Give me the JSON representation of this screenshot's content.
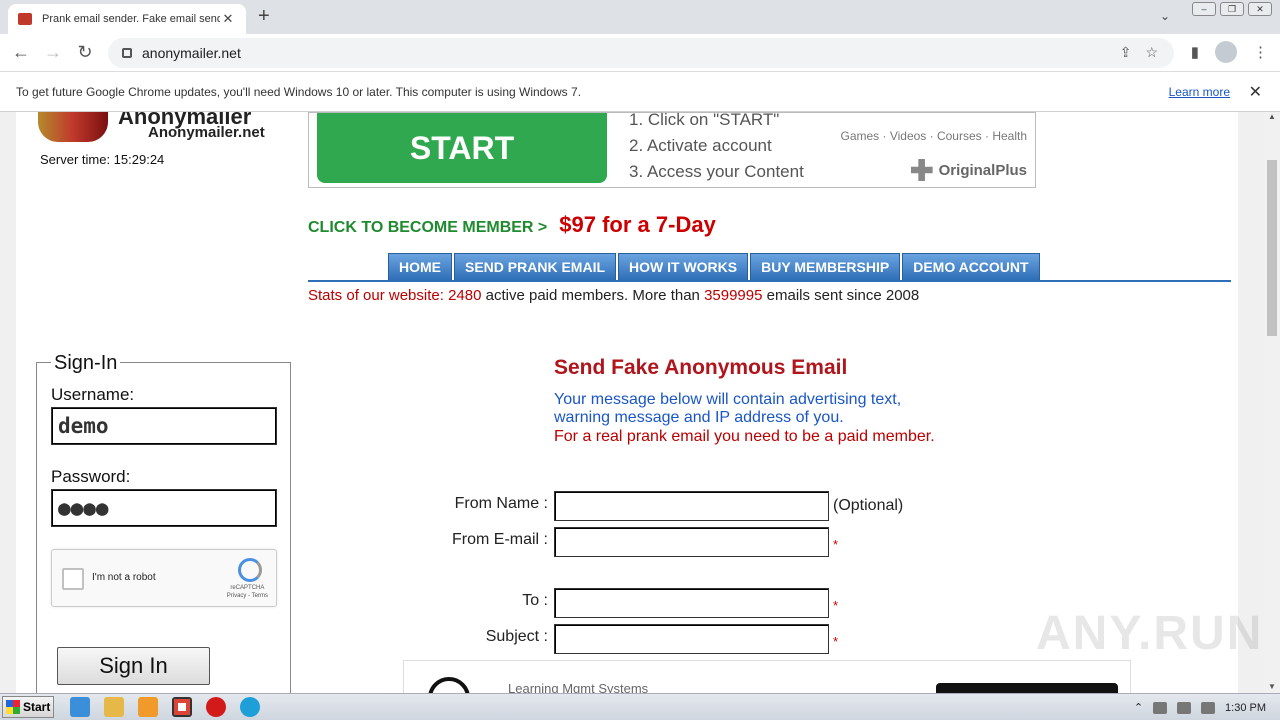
{
  "browser": {
    "tab_title": "Prank email sender. Fake email sender",
    "tab_close": "✕",
    "new_tab": "+",
    "url": "anonymailer.net",
    "infobar_text": "To get future Google Chrome updates, you'll need Windows 10 or later. This computer is using Windows 7.",
    "infobar_link": "Learn more",
    "infobar_close": "✕"
  },
  "site": {
    "logo_name": "Anonymailer.net",
    "logo_big": "Anonymailer",
    "server_time": "Server time: 15:29:24"
  },
  "ad": {
    "start_label": "START",
    "steps": [
      "1. Click on \"START\"",
      "2. Activate account",
      "3. Access your Content"
    ],
    "categories": "Games · Videos · Courses · Health",
    "brand": "OriginalPlus"
  },
  "cta": {
    "text": "CLICK TO BECOME MEMBER >",
    "price": "$97 for a 7-Day"
  },
  "nav": {
    "items": [
      "HOME",
      "SEND PRANK EMAIL",
      "HOW IT WORKS",
      "BUY MEMBERSHIP",
      "DEMO ACCOUNT"
    ]
  },
  "stats": {
    "label": "Stats of our website:",
    "members": "2480",
    "members_text": "active paid members. More than",
    "emails": "3599995",
    "emails_text": "emails sent since 2008"
  },
  "signin": {
    "legend": "Sign-In",
    "username_label": "Username:",
    "username_value": "demo",
    "password_label": "Password:",
    "password_value": "●●●●",
    "captcha_text": "I'm not a robot",
    "captcha_brand": "reCAPTCHA",
    "captcha_links": "Privacy - Terms",
    "button": "Sign In"
  },
  "form": {
    "heading": "Send Fake Anonymous Email",
    "blue_line1": "Your message below will contain advertising text,",
    "blue_line2": "warning message and IP address of you.",
    "red_line": "For a real prank email you need to be a paid member.",
    "from_name_label": "From Name :",
    "from_name_note": "(Optional)",
    "from_email_label": "From E-mail :",
    "to_label": "To :",
    "subject_label": "Subject :",
    "required_mark": "*"
  },
  "bottom_ad": {
    "text": "Learning Mgmt Systems"
  },
  "watermark": "ANY.RUN",
  "taskbar": {
    "start": "Start",
    "time": "1:30 PM"
  }
}
